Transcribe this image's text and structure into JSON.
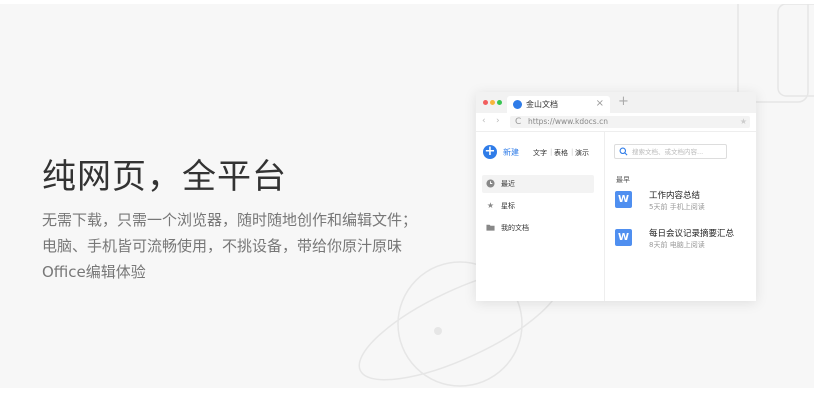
{
  "hero": {
    "title": "纯网页，全平台",
    "desc_line1": "无需下载，只需一个浏览器，随时随地创作和编辑文件；",
    "desc_line2": "电脑、手机皆可流畅使用，不挑设备，带给你原汁原味",
    "desc_line3": "Office编辑体验"
  },
  "browser": {
    "tab_title": "金山文档",
    "tab_close": "×",
    "new_tab": "+",
    "back": "‹",
    "forward": "›",
    "reload": "C",
    "url": "https://www.kdocs.cn",
    "bookmark": "★"
  },
  "app": {
    "new_label": "新建",
    "new_icon": "+",
    "create_types": [
      "文字",
      "表格",
      "演示"
    ],
    "nav": [
      {
        "label": "最近",
        "icon": "clock-icon",
        "active": true
      },
      {
        "label": "星标",
        "icon": "star-icon",
        "active": false
      },
      {
        "label": "我的文档",
        "icon": "folder-icon",
        "active": false
      }
    ],
    "search_placeholder": "搜索文档、或文档内容...",
    "section_title": "最早",
    "docs": [
      {
        "icon_letter": "W",
        "title": "工作内容总结",
        "time": "5天前",
        "source": "手机上阅读"
      },
      {
        "icon_letter": "W",
        "title": "每日会议记录摘要汇总",
        "time": "8天前",
        "source": "电脑上阅读"
      }
    ]
  },
  "colors": {
    "accent": "#2f7ce8",
    "doc_icon": "#4f8ff0",
    "traffic_red": "#f25e5e",
    "traffic_yellow": "#f7b53b",
    "traffic_green": "#37c451"
  }
}
